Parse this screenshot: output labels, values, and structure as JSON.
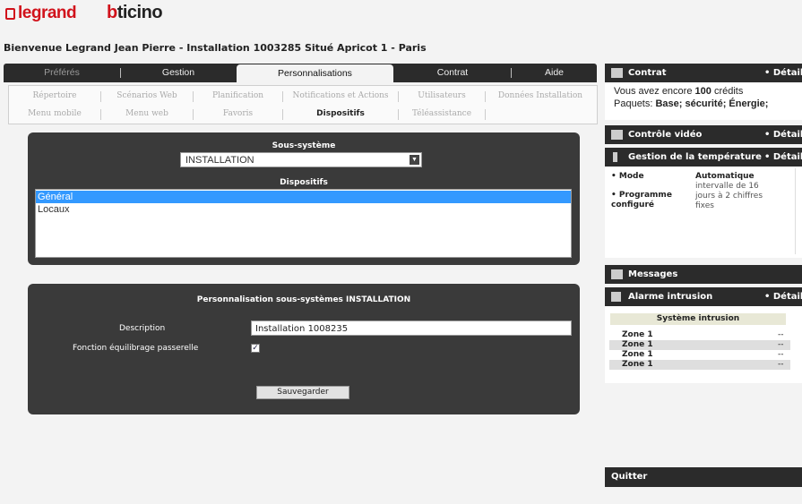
{
  "header": {
    "brand1": "legrand",
    "brand2_b": "b",
    "brand2_rest": "ticino",
    "welcome": "Bienvenue Legrand Jean Pierre - Installation 1003285 Situé Apricot 1 - Paris"
  },
  "main_tabs": [
    "Préférés",
    "Gestion",
    "Personnalisations",
    "Contrat",
    "Aide"
  ],
  "sub_tabs_row1": [
    "Répertoire",
    "Scénarios Web",
    "Planification",
    "Notifications et Actions",
    "Utilisateurs",
    "Données Installation"
  ],
  "sub_tabs_row2": [
    "Menu mobile",
    "Menu web",
    "Favoris",
    "Dispositifs",
    "Téléassistance"
  ],
  "subsystem": {
    "label": "Sous-système",
    "selected": "INSTALLATION",
    "devices_label": "Dispositifs",
    "devices": [
      "Général",
      "Locaux"
    ]
  },
  "customization": {
    "title": "Personnalisation sous-systèmes INSTALLATION",
    "description_label": "Description",
    "description_value": "Installation 1008235",
    "balance_label": "Fonction équilibrage passerelle",
    "balance_checked": true,
    "save_label": "Sauvegarder"
  },
  "sidebar": {
    "contract": {
      "title": "Contrat",
      "details": "• Détails",
      "credits_prefix": "Vous avez encore",
      "credits_value": "100",
      "credits_suffix": "crédits",
      "packages_label": "Paquets:",
      "packages_value": "Base; sécurité; Énergie;"
    },
    "video": {
      "title": "Contrôle vidéo",
      "details": "• Détails"
    },
    "temperature": {
      "title": "Gestion de la température",
      "details": "• Détails",
      "mode_label": "• Mode",
      "mode_value": "Automatique",
      "program_label": "• Programme configuré",
      "program_value": "intervalle de 16 jours à 2 chiffres fixes"
    },
    "messages": {
      "title": "Messages"
    },
    "alarm": {
      "title": "Alarme intrusion",
      "details": "• Détails",
      "system_title": "Système intrusion",
      "zones": [
        {
          "name": "Zone 1",
          "state": "--"
        },
        {
          "name": "Zone 1",
          "state": "--"
        },
        {
          "name": "Zone 1",
          "state": "--"
        },
        {
          "name": "Zone 1",
          "state": "--"
        }
      ]
    },
    "quit": "Quitter"
  },
  "colors": {
    "brand_red": "#d1121b",
    "selection_blue": "#3399ff",
    "dark_panel": "#3a3a3a"
  }
}
